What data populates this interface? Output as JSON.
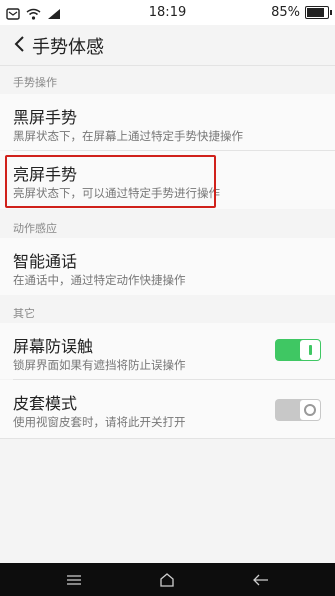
{
  "status": {
    "time": "18:19",
    "battery_text": "85%",
    "battery_level": 0.85,
    "icons": [
      "notification-icon",
      "wifi-icon",
      "signal-icon",
      "battery-icon"
    ]
  },
  "header": {
    "title": "手势体感",
    "back_icon": "back-chevron-icon"
  },
  "sections": {
    "gesture": "手势操作",
    "motion": "动作感应",
    "other": "其它"
  },
  "items": {
    "black_screen": {
      "title": "黑屏手势",
      "desc": "黑屏状态下，在屏幕上通过特定手势快捷操作"
    },
    "bright_screen": {
      "title": "亮屏手势",
      "desc": "亮屏状态下，可以通过特定手势进行操作"
    },
    "smart_call": {
      "title": "智能通话",
      "desc": "在通话中，通过特定动作快捷操作"
    },
    "screen_guard": {
      "title": "屏幕防误触",
      "desc": "锁屏界面如果有遮挡将防止误操作",
      "enabled": true
    },
    "case_mode": {
      "title": "皮套模式",
      "desc": "使用视窗皮套时，请将此开关打开",
      "enabled": false
    }
  },
  "colors": {
    "accent_on": "#3fc763",
    "highlight_border": "#d0211b"
  },
  "navbar": {
    "icons": [
      "menu-icon",
      "home-icon",
      "back-icon"
    ]
  }
}
